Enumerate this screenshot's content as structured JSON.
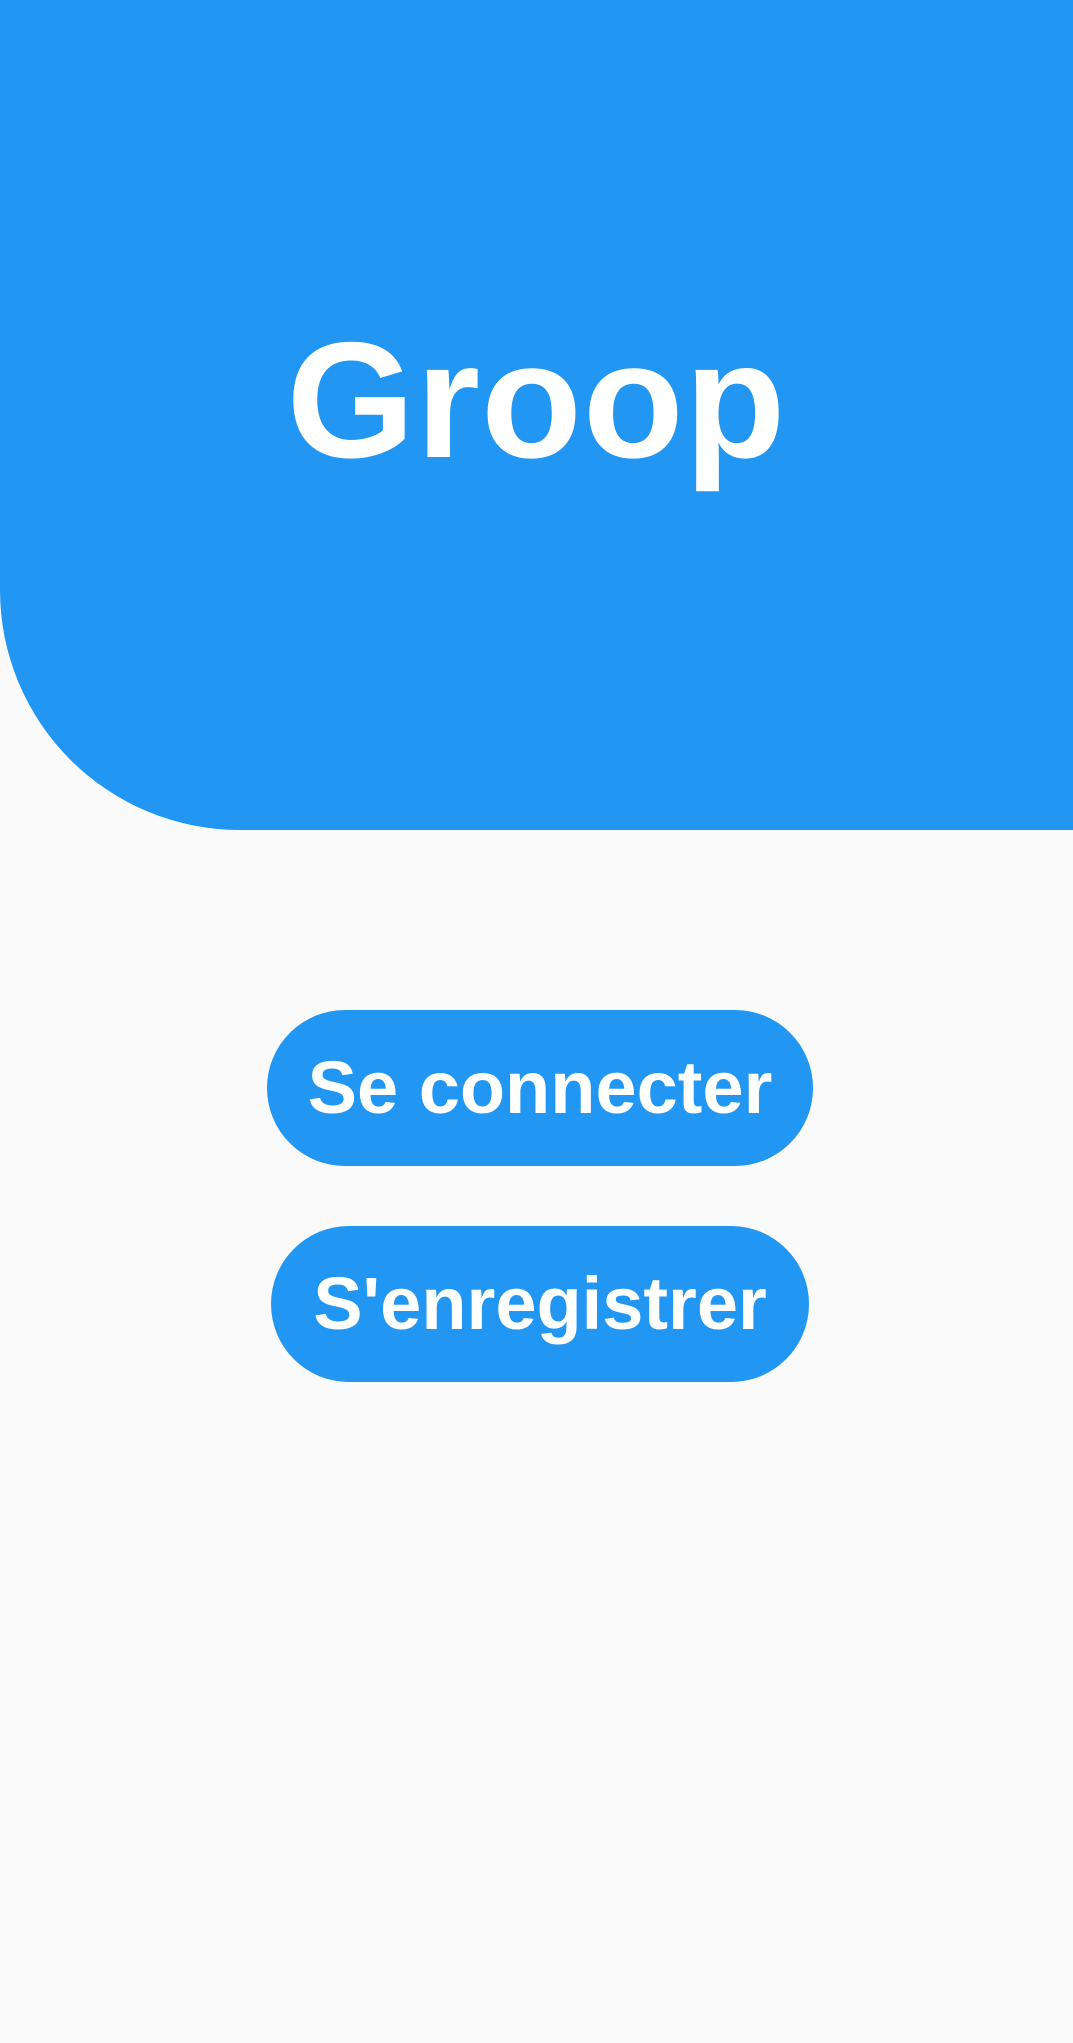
{
  "header": {
    "title": "Groop"
  },
  "actions": {
    "login_label": "Se connecter",
    "register_label": "S'enregistrer"
  },
  "colors": {
    "primary": "#2196f3",
    "background": "#fafafa",
    "on_primary": "#ffffff"
  }
}
